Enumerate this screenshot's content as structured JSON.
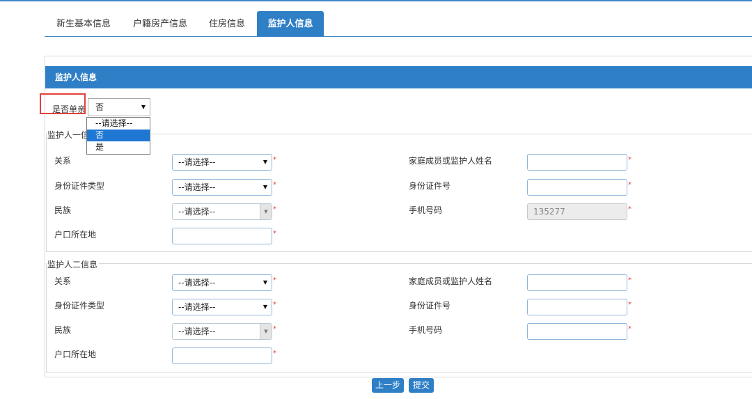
{
  "tabs": [
    "新生基本信息",
    "户籍房产信息",
    "住房信息",
    "监护人信息"
  ],
  "section_title": "监护人信息",
  "single_parent": {
    "label": "是否单亲",
    "value": "否",
    "options": [
      "--请选择--",
      "否",
      "是"
    ],
    "highlighted_option": "否"
  },
  "guardian1": {
    "legend": "监护人一信息",
    "relation_label": "关系",
    "relation_value": "--请选择--",
    "id_type_label": "身份证件类型",
    "id_type_value": "--请选择--",
    "ethnicity_label": "民族",
    "ethnicity_value": "--请选择--",
    "hukou_label": "户口所在地",
    "hukou_value": "",
    "name_label": "家庭成员或监护人姓名",
    "name_value": "",
    "id_no_label": "身份证件号",
    "id_no_value": "",
    "phone_label": "手机号码",
    "phone_value": "135277"
  },
  "guardian2": {
    "legend": "监护人二信息",
    "relation_label": "关系",
    "relation_value": "--请选择--",
    "id_type_label": "身份证件类型",
    "id_type_value": "--请选择--",
    "ethnicity_label": "民族",
    "ethnicity_value": "--请选择--",
    "hukou_label": "户口所在地",
    "hukou_value": "",
    "name_label": "家庭成员或监护人姓名",
    "name_value": "",
    "id_no_label": "身份证件号",
    "id_no_value": "",
    "phone_label": "手机号码",
    "phone_value": ""
  },
  "required_mark": "*",
  "buttons": {
    "prev": "上一步",
    "submit": "提交"
  },
  "colors": {
    "accent": "#2f7fc6",
    "highlight": "#e0423a",
    "required": "#e0423a"
  }
}
